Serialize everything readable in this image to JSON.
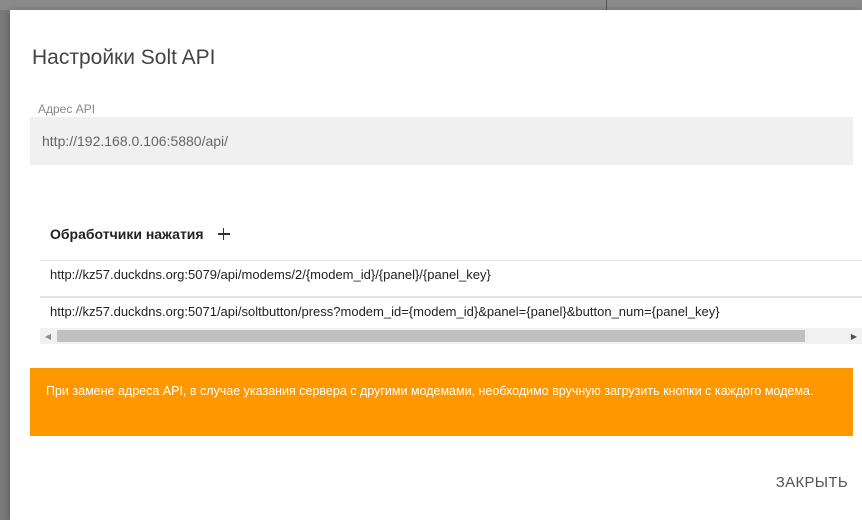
{
  "dialog": {
    "title": "Настройки Solt API",
    "api_field": {
      "label": "Адрес API",
      "value": "http://192.168.0.106:5880/api/"
    },
    "handlers": {
      "title": "Обработчики нажатия",
      "add_icon": "plus-icon",
      "items": [
        "http://kz57.duckdns.org:5079/api/modems/2/{modem_id}/{panel}/{panel_key}",
        "http://kz57.duckdns.org:5071/api/soltbutton/press?modem_id={modem_id}&panel={panel}&button_num={panel_key}"
      ]
    },
    "warning": "При замене адреса API, в случае указания сервера с другими модемами, необходимо вручную загрузить кнопки с каждого модема.",
    "close_label": "ЗАКРЫТЬ"
  },
  "colors": {
    "warning_bg": "#ff9800",
    "input_bg": "#f0f0f0",
    "backdrop": "#7a7a7a"
  },
  "scrollbar": {
    "left_icon": "arrow-left-icon",
    "right_icon": "arrow-right-icon"
  }
}
